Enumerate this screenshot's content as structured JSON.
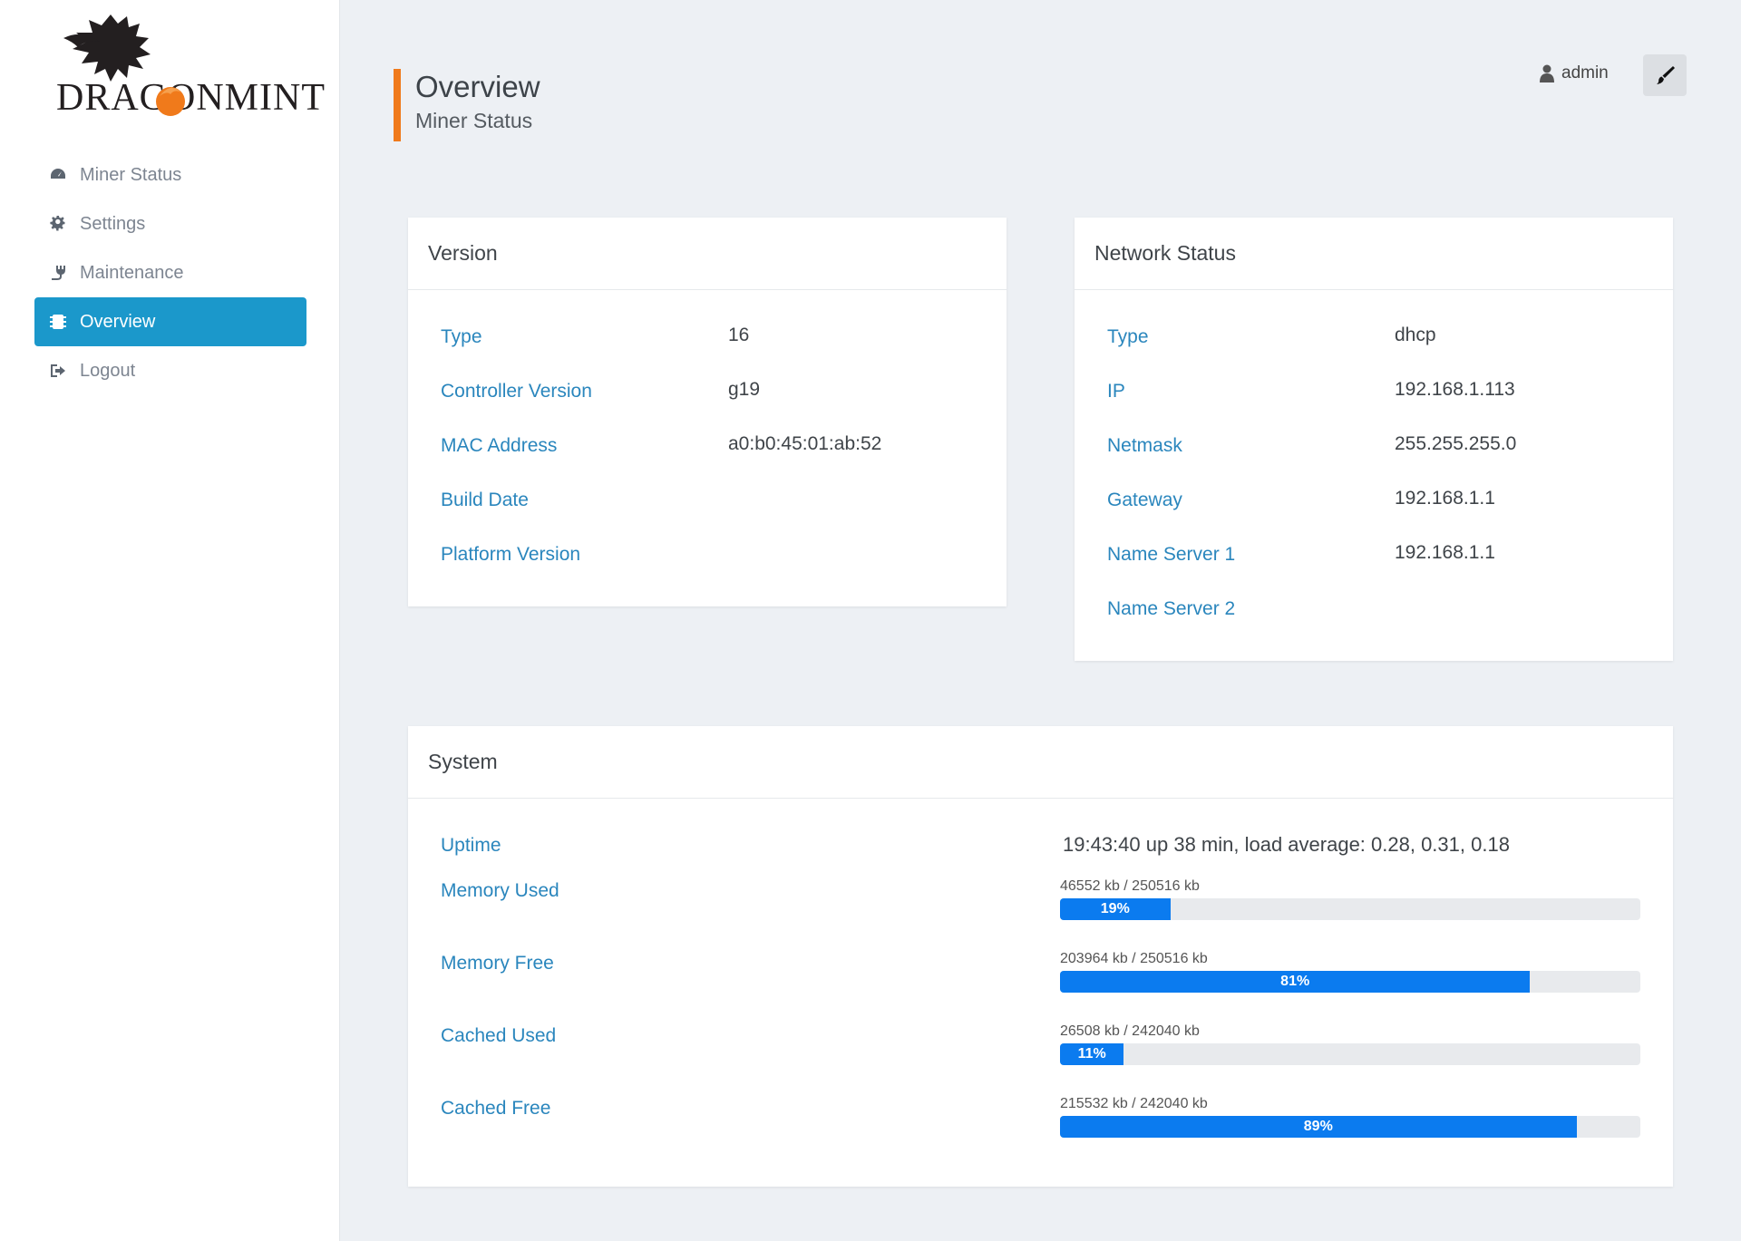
{
  "brand": {
    "logo_text": "DRAGONMINT",
    "accent_color": "#f07a1b"
  },
  "sidebar": {
    "items": [
      {
        "label": "Miner Status",
        "icon": "dashboard-icon",
        "active": false
      },
      {
        "label": "Settings",
        "icon": "gear-icon",
        "active": false
      },
      {
        "label": "Maintenance",
        "icon": "plug-icon",
        "active": false
      },
      {
        "label": "Overview",
        "icon": "chip-icon",
        "active": true
      },
      {
        "label": "Logout",
        "icon": "sign-out-icon",
        "active": false
      }
    ],
    "active_color": "#1b98cb"
  },
  "header": {
    "title": "Overview",
    "subtitle": "Miner Status",
    "user": "admin",
    "theme_button_icon": "paintbrush-icon"
  },
  "version": {
    "title": "Version",
    "rows": [
      {
        "label": "Type",
        "value": "16"
      },
      {
        "label": "Controller Version",
        "value": "g19"
      },
      {
        "label": "MAC Address",
        "value": "a0:b0:45:01:ab:52"
      },
      {
        "label": "Build Date",
        "value": ""
      },
      {
        "label": "Platform Version",
        "value": ""
      }
    ]
  },
  "network": {
    "title": "Network Status",
    "rows": [
      {
        "label": "Type",
        "value": "dhcp"
      },
      {
        "label": "IP",
        "value": "192.168.1.113"
      },
      {
        "label": "Netmask",
        "value": "255.255.255.0"
      },
      {
        "label": "Gateway",
        "value": "192.168.1.1"
      },
      {
        "label": "Name Server 1",
        "value": "192.168.1.1"
      },
      {
        "label": "Name Server 2",
        "value": ""
      }
    ]
  },
  "system": {
    "title": "System",
    "uptime_label": "Uptime",
    "uptime_value": "19:43:40 up 38 min, load average: 0.28, 0.31, 0.18",
    "meters": [
      {
        "label": "Memory Used",
        "text": "46552 kb / 250516 kb",
        "percent": 19,
        "percent_label": "19%"
      },
      {
        "label": "Memory Free",
        "text": "203964 kb / 250516 kb",
        "percent": 81,
        "percent_label": "81%"
      },
      {
        "label": "Cached Used",
        "text": "26508 kb / 242040 kb",
        "percent": 11,
        "percent_label": "11%"
      },
      {
        "label": "Cached Free",
        "text": "215532 kb / 242040 kb",
        "percent": 89,
        "percent_label": "89%"
      }
    ],
    "bar_color": "#0b7bef"
  }
}
